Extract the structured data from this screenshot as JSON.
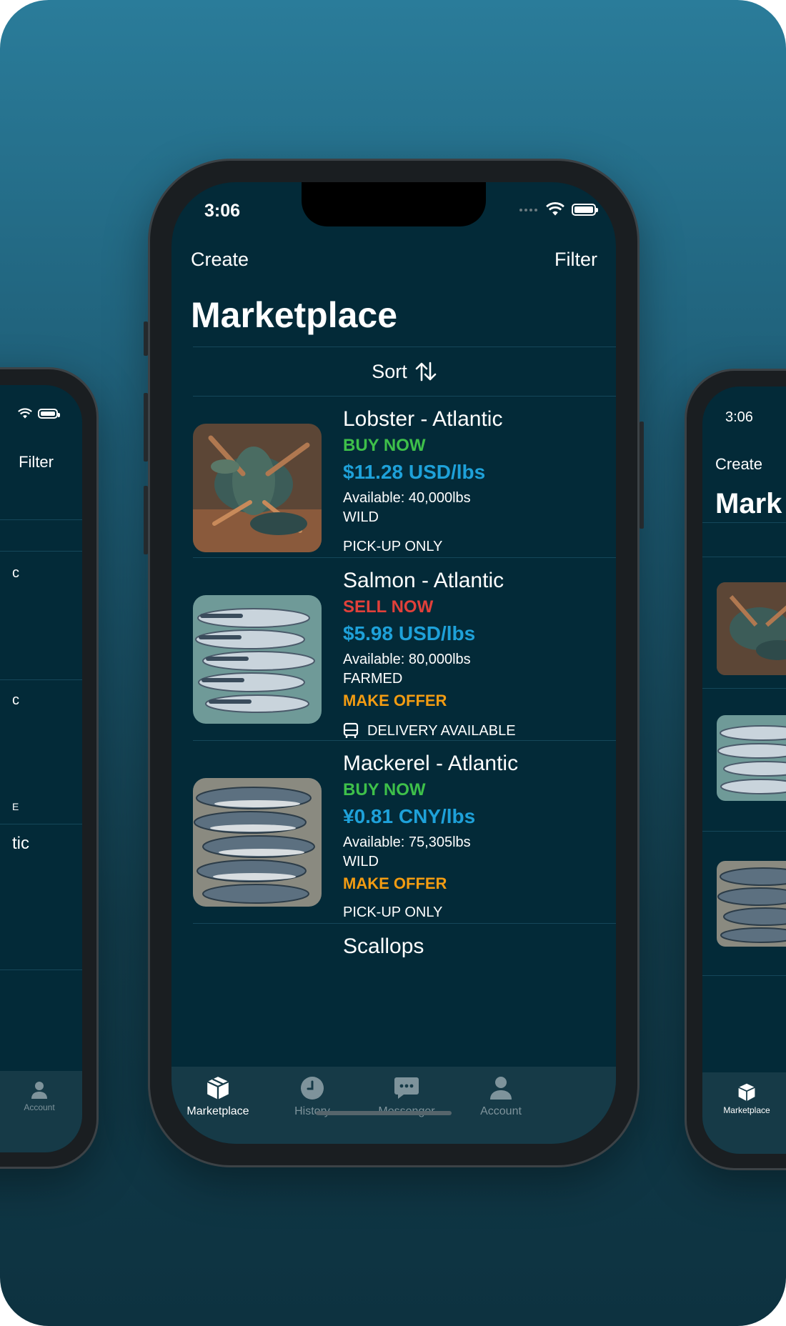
{
  "status_bar": {
    "time": "3:06"
  },
  "nav": {
    "create": "Create",
    "filter": "Filter"
  },
  "title": "Marketplace",
  "sort_label": "Sort",
  "listings": [
    {
      "title": "Lobster - Atlantic",
      "action": "BUY NOW",
      "price": "$11.28 USD/lbs",
      "available": "Available: 40,000lbs",
      "origin": "WILD",
      "offer": "",
      "shipping": "PICK-UP ONLY"
    },
    {
      "title": "Salmon - Atlantic",
      "action": "SELL NOW",
      "price": "$5.98 USD/lbs",
      "available": "Available: 80,000lbs",
      "origin": "FARMED",
      "offer": "MAKE OFFER",
      "shipping": "DELIVERY AVAILABLE"
    },
    {
      "title": "Mackerel - Atlantic",
      "action": "BUY NOW",
      "price": "¥0.81 CNY/lbs",
      "available": "Available: 75,305lbs",
      "origin": "WILD",
      "offer": "MAKE OFFER",
      "shipping": "PICK-UP ONLY"
    },
    {
      "title": "Scallops"
    }
  ],
  "tabs": [
    {
      "label": "Marketplace",
      "icon": "package-icon"
    },
    {
      "label": "History",
      "icon": "clock-icon"
    },
    {
      "label": "Messenger",
      "icon": "chat-icon"
    },
    {
      "label": "Account",
      "icon": "person-icon"
    }
  ],
  "left_phone": {
    "filter": "Filter",
    "fragments": [
      "c",
      "c",
      "E",
      "tic"
    ],
    "tab_label": "Account"
  },
  "right_phone": {
    "time": "3:06",
    "create": "Create",
    "title_fragment": "Mark",
    "tab_label": "Marketplace"
  },
  "colors": {
    "buy": "#3ec04a",
    "sell": "#e2403a",
    "offer": "#f39c12",
    "price": "#1ea1d9",
    "screen_bg": "#032a38"
  }
}
